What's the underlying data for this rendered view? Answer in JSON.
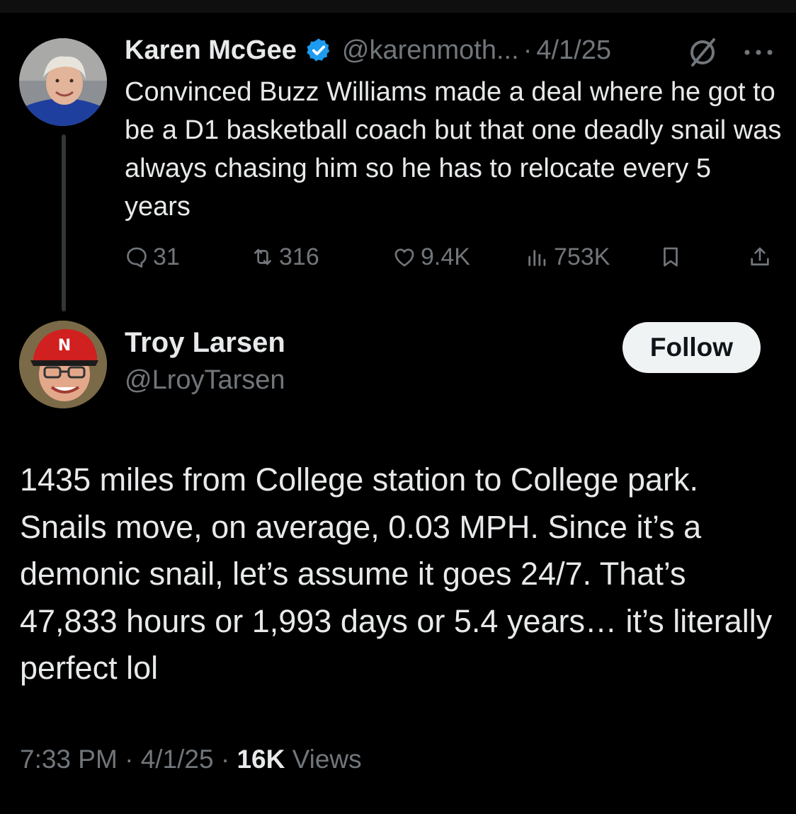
{
  "original_tweet": {
    "author_name": "Karen McGee",
    "author_handle": "@karenmoth...",
    "separator": "·",
    "date": "4/1/25",
    "verified": true,
    "text": "Convinced Buzz Williams made a deal where he got to be a D1 basketball coach but that one deadly snail was always chasing him so he has to relocate every 5 years",
    "stats": {
      "replies": "31",
      "retweets": "316",
      "likes": "9.4K",
      "views": "753K"
    }
  },
  "reply_tweet": {
    "author_name": "Troy Larsen",
    "author_handle": "@LroyTarsen",
    "follow_label": "Follow",
    "text": "1435 miles from College station to College park. Snails move, on average, 0.03 MPH. Since it’s a demonic snail, let’s assume it goes 24/7. That’s 47,833 hours or 1,993 days or 5.4 years… it’s literally perfect lol",
    "time": "7:33 PM",
    "separator": "·",
    "date": "4/1/25",
    "views_count": "16K",
    "views_label": "Views"
  },
  "icons": {
    "verified": "verified-badge-icon",
    "grok": "grok-icon",
    "more": "more-icon",
    "reply": "reply-icon",
    "retweet": "retweet-icon",
    "like": "heart-icon",
    "views": "views-icon",
    "bookmark": "bookmark-icon",
    "share": "share-icon"
  },
  "colors": {
    "background": "#000000",
    "text_primary": "#e7e9ea",
    "text_secondary": "#71767b",
    "verified_blue": "#1d9bf0",
    "follow_bg": "#eff3f4",
    "follow_text": "#0f1419"
  }
}
